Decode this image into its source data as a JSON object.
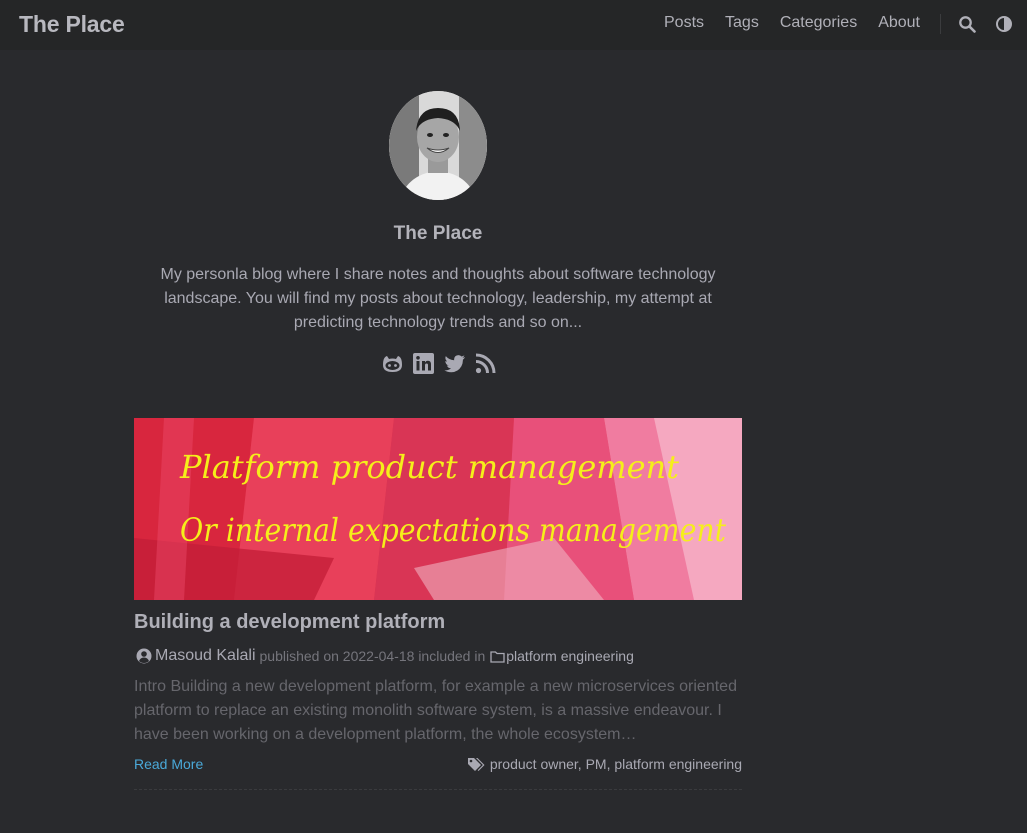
{
  "header": {
    "site_title": "The Place",
    "nav": [
      "Posts",
      "Tags",
      "Categories",
      "About"
    ]
  },
  "profile": {
    "name": "The Place",
    "description": "My personla blog where I share notes and thoughts about software technology landscape. You will find my posts about technology, leadership, my attempt at predicting technology trends and so on..."
  },
  "post": {
    "cover_line1": "Platform product management",
    "cover_line2": "Or internal expectations management",
    "title": "Building a development platform",
    "author": "Masoud Kalali",
    "published_prefix": "published on",
    "date": "2022-04-18",
    "included_text": "included in",
    "category": "platform engineering",
    "excerpt": "Intro Building a new development platform, for example a new microservices oriented platform to replace an existing monolith software system, is a massive endeavour. I have been working on a development platform, the whole ecosystem…",
    "read_more": "Read More",
    "tags": "product owner, PM, platform engineering"
  },
  "colors": {
    "background": "#292a2d",
    "header": "#252627",
    "link": "#4aa9d9",
    "cover_text": "#f5ef1a"
  }
}
